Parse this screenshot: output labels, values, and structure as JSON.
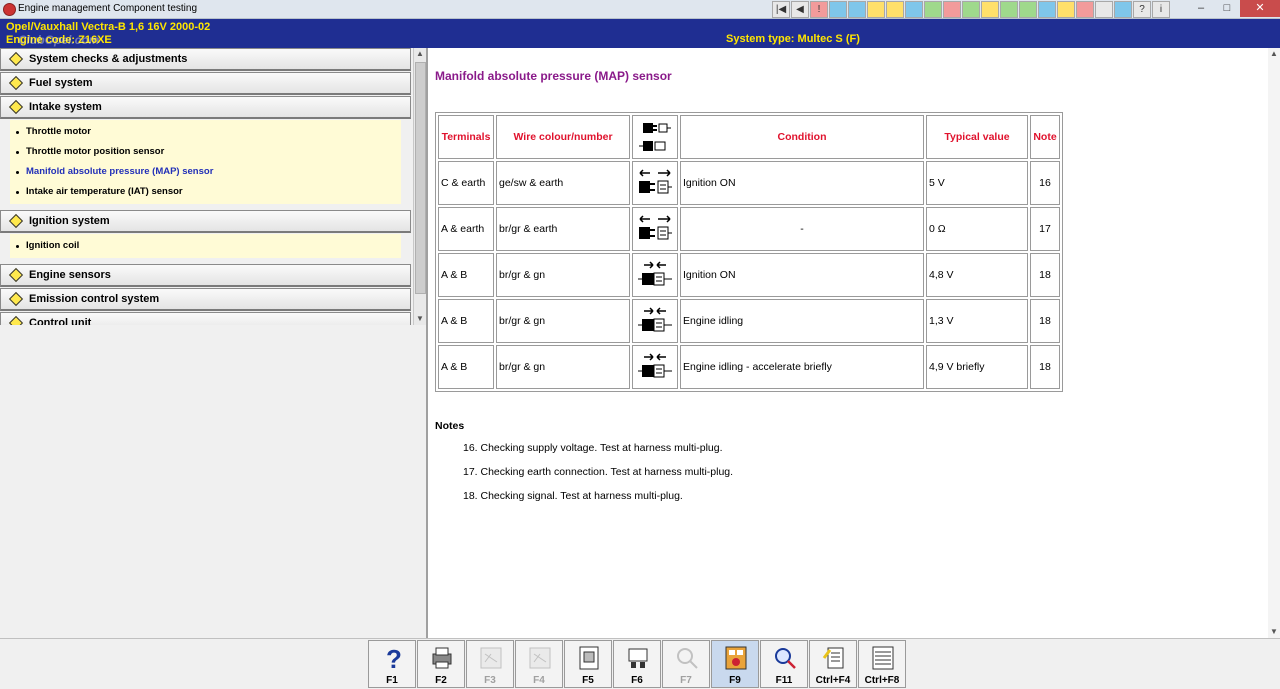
{
  "window": {
    "title": "Engine management Component testing",
    "close": "✕",
    "minimize": "–",
    "maximize": "□"
  },
  "vehicle": {
    "line1": "Opel/Vauxhall   Vectra-B  1,6 16V 2000-02",
    "line2": "Engine code: Z16XE",
    "system_type": "System type: Multec S (F)",
    "watermark": "ClubOpel.com"
  },
  "toolbar": {
    "icons": [
      "first-icon",
      "prev-icon",
      "warning-icon",
      "book-icon",
      "diagram-icon",
      "gear-icon",
      "wrench-icon",
      "pin-icon",
      "wire-icon",
      "fuse-icon",
      "doc-icon",
      "check-icon",
      "sensor-icon",
      "battery-icon",
      "key-icon",
      "car-icon",
      "ok-icon",
      "print-icon",
      "tool-icon",
      "help-icon",
      "info-icon"
    ]
  },
  "sidebar": {
    "categories": [
      {
        "label": "System checks & adjustments",
        "items": []
      },
      {
        "label": "Fuel system",
        "items": []
      },
      {
        "label": "Intake system",
        "items": [
          {
            "label": "Throttle motor",
            "active": false
          },
          {
            "label": "Throttle motor position sensor",
            "active": false
          },
          {
            "label": "Manifold absolute pressure (MAP) sensor",
            "active": true
          },
          {
            "label": "Intake air temperature (IAT) sensor",
            "active": false
          }
        ]
      },
      {
        "label": "Ignition system",
        "items": [
          {
            "label": "Ignition coil",
            "active": false
          }
        ]
      },
      {
        "label": "Engine sensors",
        "items": []
      },
      {
        "label": "Emission control system",
        "items": []
      },
      {
        "label": "Control unit",
        "items": []
      }
    ]
  },
  "main": {
    "heading": "Manifold absolute pressure (MAP) sensor",
    "table": {
      "headers": {
        "terminals": "Terminals",
        "wire": "Wire colour/number",
        "condition": "Condition",
        "typical": "Typical value",
        "note": "Note"
      },
      "rows": [
        {
          "terminals": "C & earth",
          "wire": "ge/sw & earth",
          "icon": "plug-separated-icon",
          "condition": "Ignition ON",
          "value": "5 V",
          "note": "16"
        },
        {
          "terminals": "A & earth",
          "wire": "br/gr & earth",
          "icon": "plug-separated-icon",
          "condition": "-",
          "value": "0 Ω",
          "note": "17"
        },
        {
          "terminals": "A & B",
          "wire": "br/gr & gn",
          "icon": "plug-connected-icon",
          "condition": "Ignition ON",
          "value": "4,8 V",
          "note": "18"
        },
        {
          "terminals": "A & B",
          "wire": "br/gr & gn",
          "icon": "plug-connected-icon",
          "condition": "Engine idling",
          "value": "1,3 V",
          "note": "18"
        },
        {
          "terminals": "A & B",
          "wire": "br/gr & gn",
          "icon": "plug-connected-icon",
          "condition": "Engine idling - accelerate briefly",
          "value": "4,9 V briefly",
          "note": "18"
        }
      ]
    },
    "notes": {
      "title": "Notes",
      "items": [
        "16. Checking supply voltage. Test at harness multi-plug.",
        "17. Checking earth connection. Test at harness multi-plug.",
        "18. Checking signal. Test at harness multi-plug."
      ]
    }
  },
  "fkeys": [
    {
      "label": "F1",
      "icon": "help-icon",
      "enabled": true
    },
    {
      "label": "F2",
      "icon": "print-icon",
      "enabled": true
    },
    {
      "label": "F3",
      "icon": "diagram-icon",
      "enabled": false
    },
    {
      "label": "F4",
      "icon": "diagram-icon",
      "enabled": false
    },
    {
      "label": "F5",
      "icon": "component-icon",
      "enabled": true
    },
    {
      "label": "F6",
      "icon": "plug-icon",
      "enabled": true
    },
    {
      "label": "F7",
      "icon": "probe-icon",
      "enabled": false
    },
    {
      "label": "F9",
      "icon": "ecu-icon",
      "enabled": true,
      "selected": true
    },
    {
      "label": "F11",
      "icon": "diagnostic-icon",
      "enabled": true
    },
    {
      "label": "Ctrl+F4",
      "icon": "notes-icon",
      "enabled": true
    },
    {
      "label": "Ctrl+F8",
      "icon": "list-icon",
      "enabled": true
    }
  ]
}
